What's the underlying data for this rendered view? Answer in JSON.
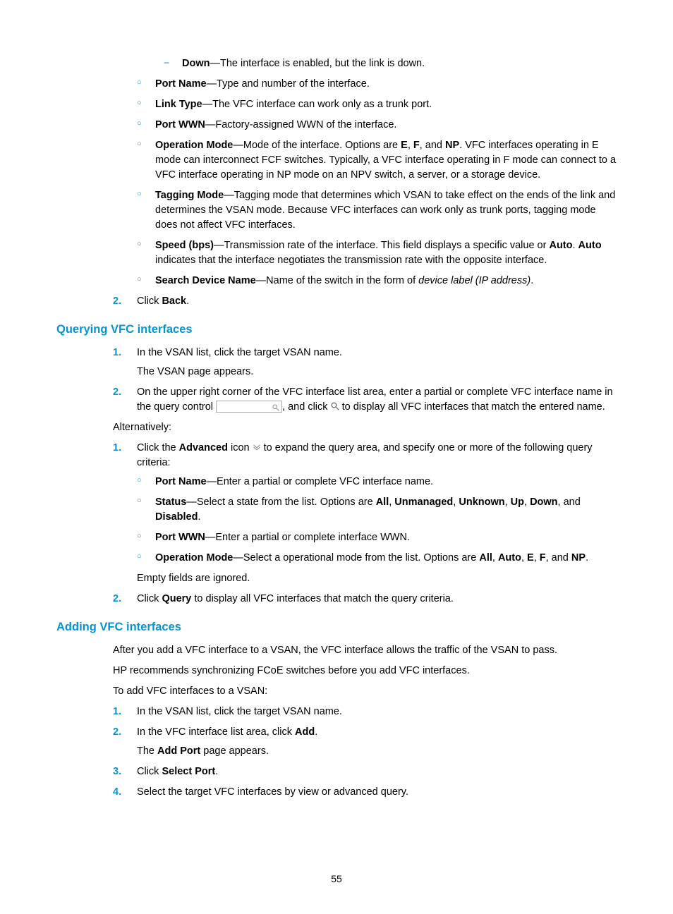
{
  "pageNumber": "55",
  "dash1": {
    "term": "Down",
    "desc": "—The interface is enabled, but the link is down."
  },
  "topCirc": {
    "portName": {
      "term": "Port Name",
      "desc": "—Type and number of the interface."
    },
    "linkType": {
      "term": "Link Type",
      "desc": "—The VFC interface can work only as a trunk port."
    },
    "portWWN": {
      "term": "Port WWN",
      "desc": "—Factory-assigned WWN of the interface."
    },
    "opMode": {
      "term": "Operation Mode",
      "pre": "—Mode of the interface. Options are ",
      "e": "E",
      "c1": ", ",
      "f": "F",
      "c2": ", and ",
      "np": "NP",
      "post": ". VFC interfaces operating in E mode can interconnect FCF switches. Typically, a VFC interface operating in F mode can connect to a VFC interface operating in NP mode on an NPV switch, a server, or a storage device."
    },
    "tagging": {
      "term": "Tagging Mode",
      "desc": "—Tagging mode that determines which VSAN to take effect on the ends of the link and determines the VSAN mode. Because VFC interfaces can work only as trunk ports, tagging mode does not affect VFC interfaces."
    },
    "speed": {
      "term": "Speed (bps)",
      "pre": "—Transmission rate of the interface. This field displays a specific value or ",
      "auto1": "Auto",
      "mid": ". ",
      "auto2": "Auto",
      "post": " indicates that the interface negotiates the transmission rate with the opposite interface."
    },
    "search": {
      "term": "Search Device Name",
      "pre": "—Name of the switch in the form of ",
      "ital": "device label (IP address)",
      "post": "."
    }
  },
  "top2": {
    "pre": "Click ",
    "b": "Back",
    "post": "."
  },
  "sec1": {
    "title": "Querying VFC interfaces",
    "s1": {
      "line1": "In the VSAN list, click the target VSAN name.",
      "line2": "The VSAN page appears."
    },
    "s2": {
      "pre": "On the upper right corner of the VFC interface list area, enter a partial or complete VFC interface name in the query control ",
      "mid": ", and click ",
      "post": " to display all VFC interfaces that match the entered name."
    },
    "alt": "Alternatively:",
    "a1": {
      "pre": "Click the ",
      "b": "Advanced",
      "mid": " icon ",
      "post": " to expand the query area, and specify one or more of the following query criteria:"
    },
    "crit": {
      "portName": {
        "term": "Port Name",
        "desc": "—Enter a partial or complete VFC interface name."
      },
      "status": {
        "term": "Status",
        "pre": "—Select a state from the list. Options are ",
        "all": "All",
        "c1": ", ",
        "unm": "Unmanaged",
        "c2": ", ",
        "unk": "Unknown",
        "c3": ", ",
        "up": "Up",
        "c4": ", ",
        "dn": "Down",
        "c5": ", and ",
        "dis": "Disabled",
        "post": "."
      },
      "portWWN": {
        "term": "Port WWN",
        "desc": "—Enter a partial or complete interface WWN."
      },
      "opMode": {
        "term": "Operation Mode",
        "pre": "—Select a operational mode from the list. Options are ",
        "all": "All",
        "c1": ", ",
        "auto": "Auto",
        "c2": ", ",
        "e": "E",
        "c3": ", ",
        "f": "F",
        "c4": ", and ",
        "np": "NP",
        "post": "."
      }
    },
    "empty": "Empty fields are ignored.",
    "a2": {
      "pre": "Click ",
      "b": "Query",
      "post": " to display all VFC interfaces that match the query criteria."
    }
  },
  "sec2": {
    "title": "Adding VFC interfaces",
    "p1": "After you add a VFC interface to a VSAN, the VFC interface allows the traffic of the VSAN to pass.",
    "p2": "HP recommends synchronizing FCoE switches before you add VFC interfaces.",
    "p3": "To add VFC interfaces to a VSAN:",
    "s1": "In the VSAN list, click the target VSAN name.",
    "s2": {
      "pre": "In the VFC interface list area, click ",
      "b": "Add",
      "post": ".",
      "sub_pre": "The ",
      "sub_b": "Add Port",
      "sub_post": " page appears."
    },
    "s3": {
      "pre": "Click ",
      "b": "Select Port",
      "post": "."
    },
    "s4": "Select the target VFC interfaces by view or advanced query."
  }
}
